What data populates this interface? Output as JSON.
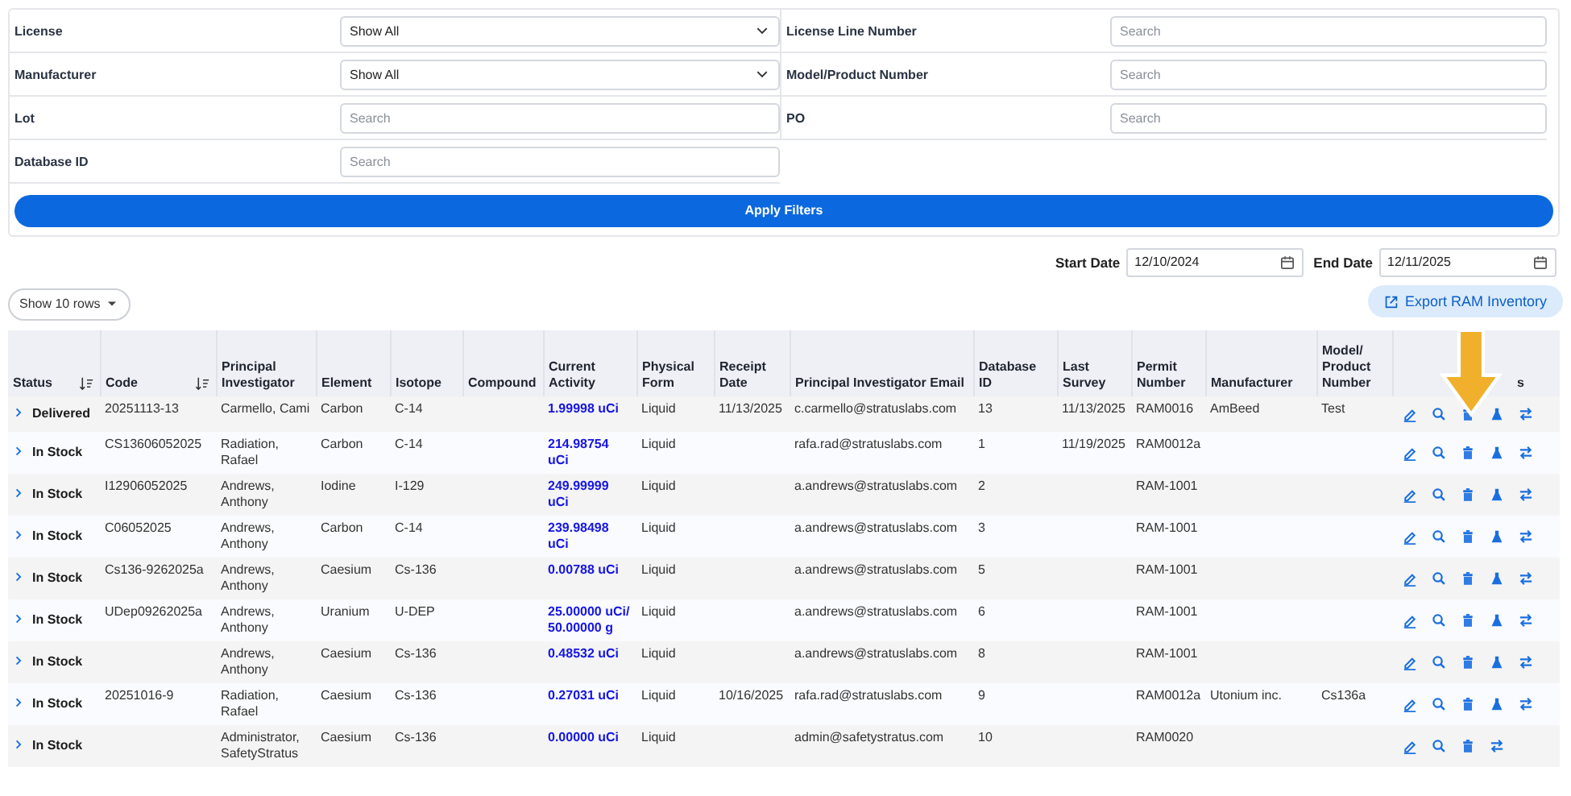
{
  "filters": [
    {
      "label": "License",
      "kind": "select",
      "value": "Show All"
    },
    {
      "label": "License Line Number",
      "kind": "search",
      "placeholder": "Search"
    },
    {
      "label": "Manufacturer",
      "kind": "select",
      "value": "Show All"
    },
    {
      "label": "Model/Product Number",
      "kind": "search",
      "placeholder": "Search"
    },
    {
      "label": "Lot",
      "kind": "search",
      "placeholder": "Search"
    },
    {
      "label": "PO",
      "kind": "search",
      "placeholder": "Search"
    },
    {
      "label": "Database ID",
      "kind": "search",
      "placeholder": "Search"
    }
  ],
  "apply_button": "Apply Filters",
  "dates": [
    {
      "label": "Start Date",
      "value": "12/10/2024"
    },
    {
      "label": "End Date",
      "value": "12/11/2025"
    }
  ],
  "rows_selector": "Show 10 rows",
  "export_button": "Export RAM Inventory",
  "table": {
    "columns": [
      {
        "label": "Status",
        "kind": "status",
        "sortable": true
      },
      {
        "label": "Code",
        "kind": "text",
        "sortable": true
      },
      {
        "label": "Principal Investigator",
        "kind": "text",
        "sortable": false
      },
      {
        "label": "Element",
        "kind": "text",
        "sortable": false
      },
      {
        "label": "Isotope",
        "kind": "text",
        "sortable": false
      },
      {
        "label": "Compound",
        "kind": "text",
        "sortable": false
      },
      {
        "label": "Current Activity",
        "kind": "activity",
        "sortable": false
      },
      {
        "label": "Physical Form",
        "kind": "text",
        "sortable": false
      },
      {
        "label": "Receipt Date",
        "kind": "text",
        "sortable": false
      },
      {
        "label": "Principal Investigator Email",
        "kind": "text",
        "sortable": false
      },
      {
        "label": "Database ID",
        "kind": "text",
        "sortable": false
      },
      {
        "label": "Last Survey",
        "kind": "text",
        "sortable": false
      },
      {
        "label": "Permit Number",
        "kind": "text",
        "sortable": false
      },
      {
        "label": "Manufacturer",
        "kind": "text",
        "sortable": false
      },
      {
        "label": "Model/ Product Number",
        "kind": "text",
        "sortable": false
      },
      {
        "label": "s",
        "kind": "actions",
        "sortable": false
      }
    ],
    "rows": [
      {
        "cells": [
          "Delivered",
          "20251113-13",
          "Carmello, Cami",
          "Carbon",
          "C-14",
          null,
          "1.99998 uCi",
          "Liquid",
          "11/13/2025",
          "c.carmello@stratuslabs.com",
          "13",
          "11/13/2025",
          "RAM0016",
          "AmBeed",
          "Test"
        ],
        "flask_action": true
      },
      {
        "cells": [
          "In Stock",
          "CS13606052025",
          "Radiation, Rafael",
          "Carbon",
          "C-14",
          null,
          "214.98754 uCi",
          "Liquid",
          null,
          "rafa.rad@stratuslabs.com",
          "1",
          "11/19/2025",
          "RAM0012a",
          null,
          null
        ],
        "flask_action": true
      },
      {
        "cells": [
          "In Stock",
          "I12906052025",
          "Andrews, Anthony",
          "Iodine",
          "I-129",
          null,
          "249.99999 uCi",
          "Liquid",
          null,
          "a.andrews@stratuslabs.com",
          "2",
          null,
          "RAM-1001",
          null,
          null
        ],
        "flask_action": true
      },
      {
        "cells": [
          "In Stock",
          "C06052025",
          "Andrews, Anthony",
          "Carbon",
          "C-14",
          null,
          "239.98498 uCi",
          "Liquid",
          null,
          "a.andrews@stratuslabs.com",
          "3",
          null,
          "RAM-1001",
          null,
          null
        ],
        "flask_action": true
      },
      {
        "cells": [
          "In Stock",
          "Cs136-9262025a",
          "Andrews, Anthony",
          "Caesium",
          "Cs-136",
          null,
          "0.00788 uCi",
          "Liquid",
          null,
          "a.andrews@stratuslabs.com",
          "5",
          null,
          "RAM-1001",
          null,
          null
        ],
        "flask_action": true
      },
      {
        "cells": [
          "In Stock",
          "UDep09262025a",
          "Andrews, Anthony",
          "Uranium",
          "U-DEP",
          null,
          "25.00000 uCi/ 50.00000 g",
          "Liquid",
          null,
          "a.andrews@stratuslabs.com",
          "6",
          null,
          "RAM-1001",
          null,
          null
        ],
        "flask_action": true
      },
      {
        "cells": [
          "In Stock",
          null,
          "Andrews, Anthony",
          "Caesium",
          "Cs-136",
          null,
          "0.48532 uCi",
          "Liquid",
          null,
          "a.andrews@stratuslabs.com",
          "8",
          null,
          "RAM-1001",
          null,
          null
        ],
        "flask_action": true
      },
      {
        "cells": [
          "In Stock",
          "20251016-9",
          "Radiation, Rafael",
          "Caesium",
          "Cs-136",
          null,
          "0.27031 uCi",
          "Liquid",
          "10/16/2025",
          "rafa.rad@stratuslabs.com",
          "9",
          null,
          "RAM0012a",
          "Utonium inc.",
          "Cs136a"
        ],
        "flask_action": true
      },
      {
        "cells": [
          "In Stock",
          null,
          "Administrator, SafetyStratus",
          "Caesium",
          "Cs-136",
          null,
          "0.00000 uCi",
          "Liquid",
          null,
          "admin@safetystratus.com",
          "10",
          null,
          "RAM0020",
          null,
          null
        ],
        "flask_action": false
      }
    ]
  }
}
